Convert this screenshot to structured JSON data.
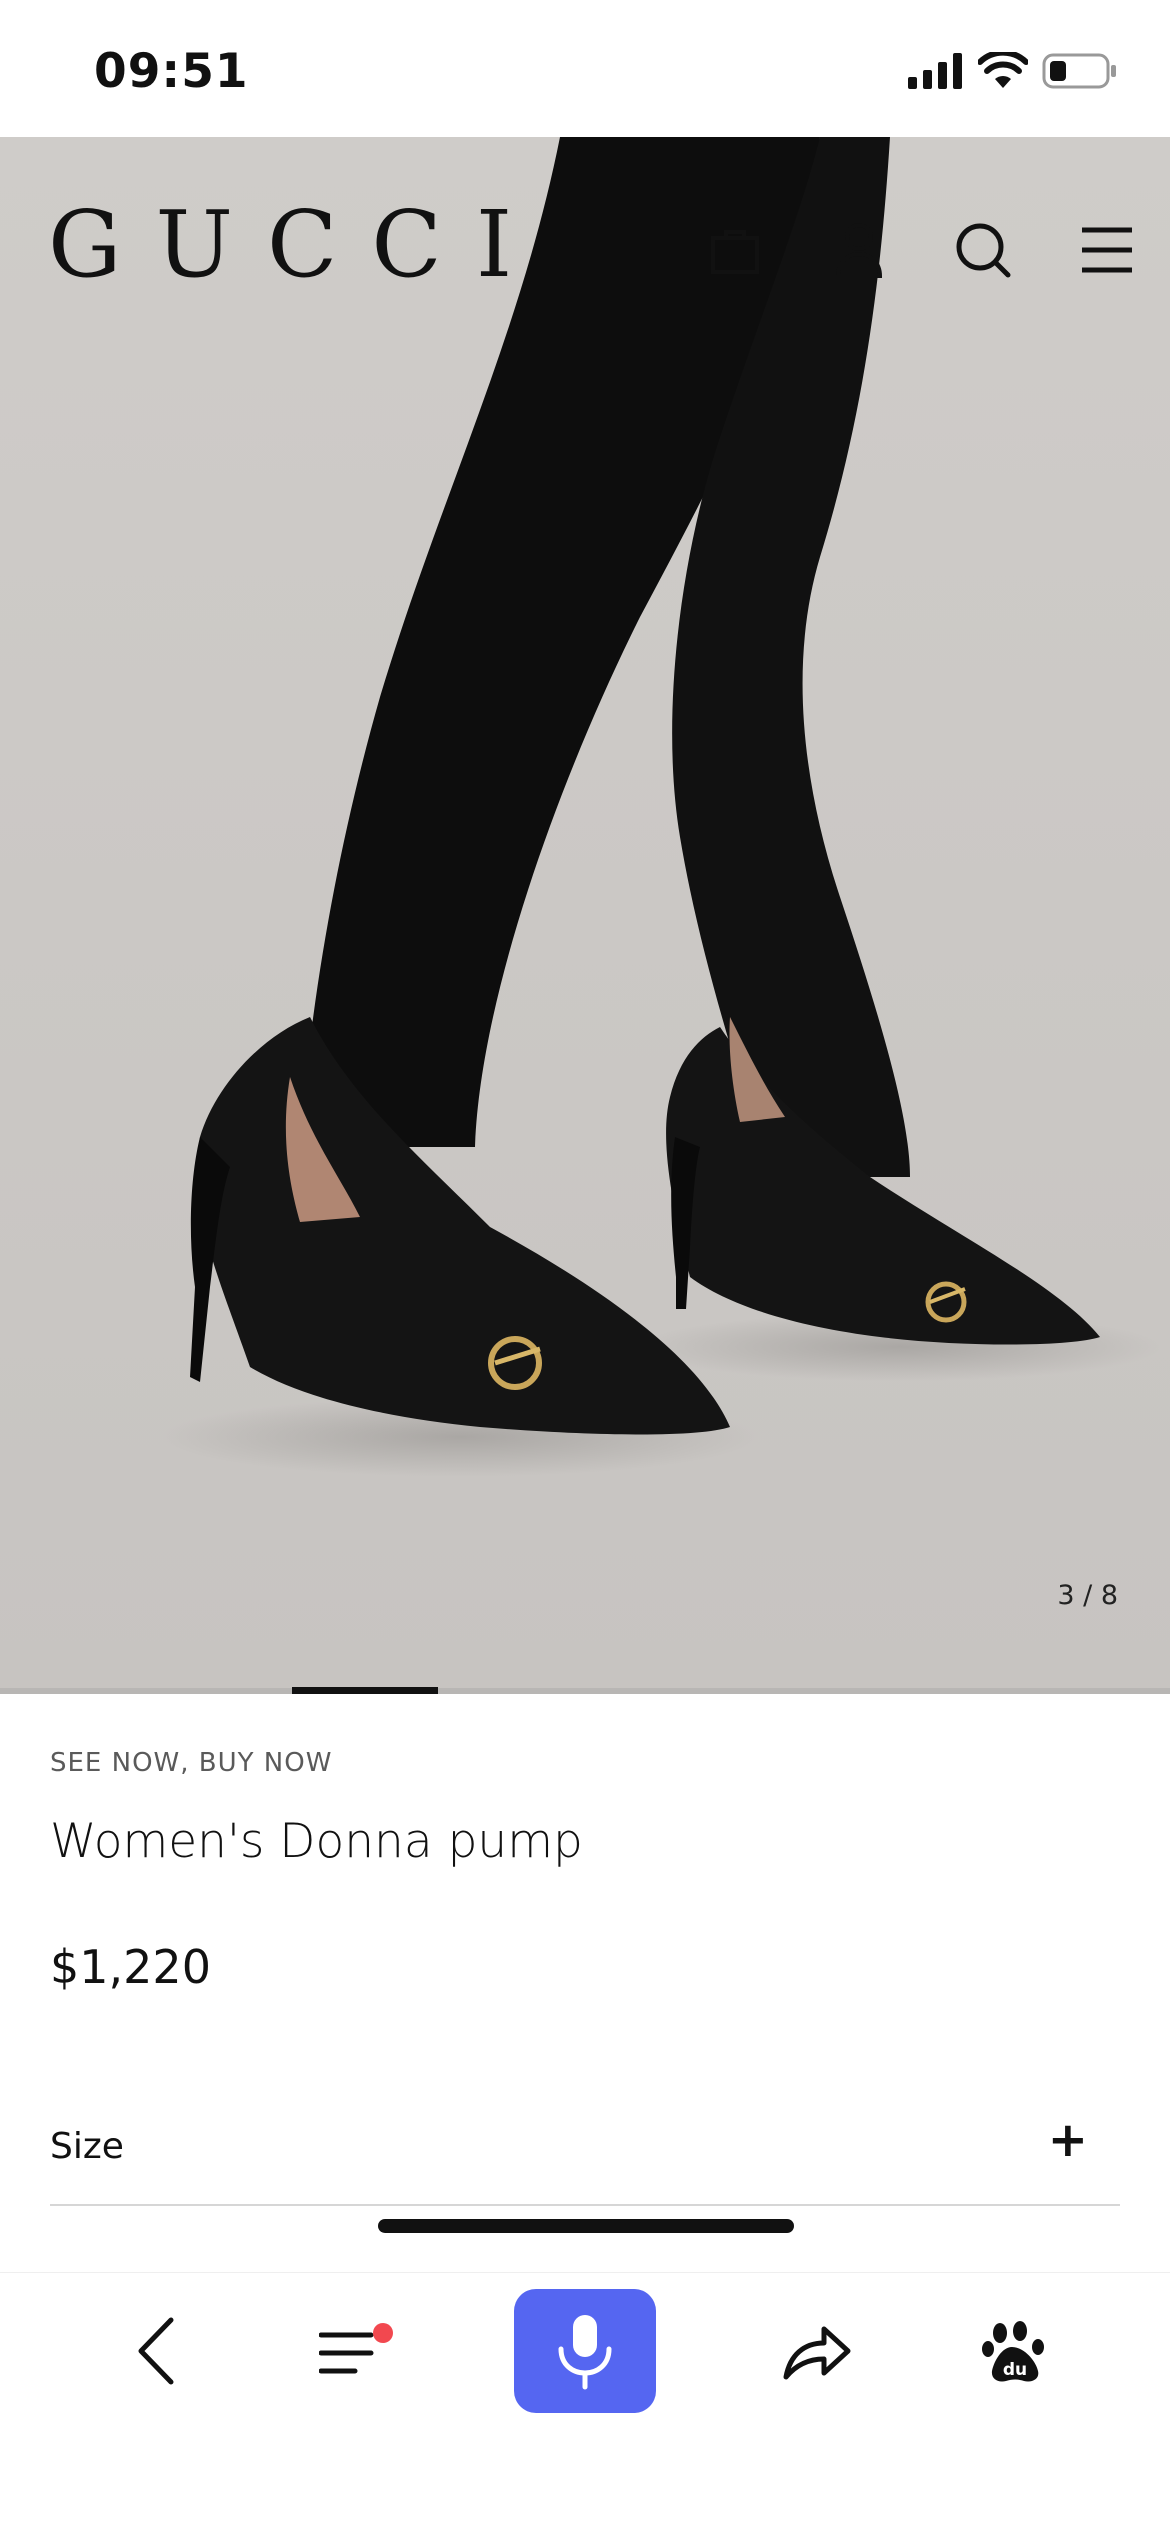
{
  "status_bar": {
    "time": "09:51"
  },
  "header": {
    "logo": "GUCCI",
    "icons": [
      "shopping-bag-icon",
      "account-icon",
      "search-icon",
      "menu-icon"
    ]
  },
  "gallery": {
    "counter": "3 / 8",
    "current": 3,
    "total": 8
  },
  "product": {
    "eyebrow": "SEE NOW, BUY NOW",
    "name": "Women's Donna pump",
    "price": "$1,220",
    "size_label": "Size",
    "size_expand": "+"
  },
  "bottom_bar": {
    "items": [
      "back-icon",
      "tabs-menu-icon",
      "microphone-icon",
      "share-icon",
      "baidu-paw-icon"
    ],
    "mic_color": "#5566f1",
    "notification_color": "#f2484f"
  }
}
